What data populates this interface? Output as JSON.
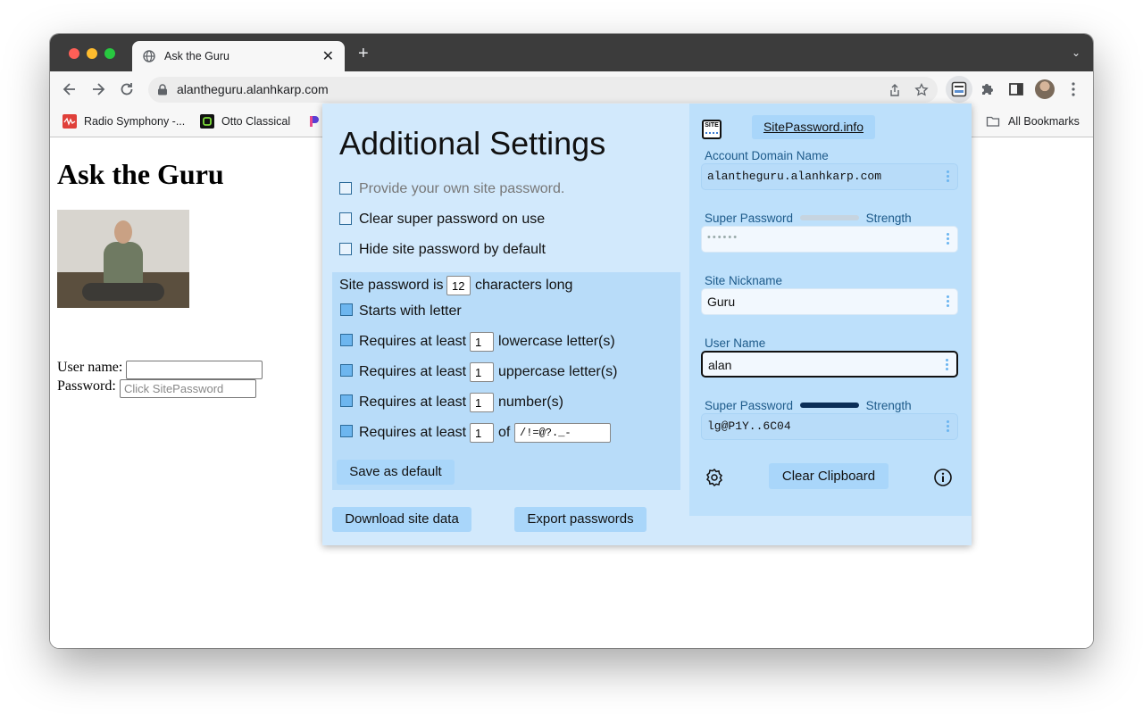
{
  "browser": {
    "tab_title": "Ask the Guru",
    "url": "alantheguru.alanhkarp.com",
    "bookmarks": [
      "Radio Symphony -...",
      "Otto Classical",
      "All Bookmarks"
    ]
  },
  "page": {
    "heading": "Ask the Guru",
    "username_label": "User name:",
    "password_label": "Password:",
    "password_placeholder": "Click SitePassword"
  },
  "popup": {
    "title": "Additional Settings",
    "options": {
      "provide_own": "Provide your own site password.",
      "clear_super": "Clear super password on use",
      "hide_site": "Hide site password by default"
    },
    "rules": {
      "length_prefix": "Site password is",
      "length_value": "12",
      "length_suffix": "characters long",
      "starts_with_letter": "Starts with letter",
      "requires_prefix": "Requires at least",
      "lower_value": "1",
      "lower_suffix": "lowercase letter(s)",
      "upper_value": "1",
      "upper_suffix": "uppercase letter(s)",
      "number_value": "1",
      "number_suffix": "number(s)",
      "special_value": "1",
      "special_of": "of",
      "special_chars": "/!=@?._-"
    },
    "save_default": "Save as default",
    "download": "Download site data",
    "export": "Export passwords",
    "site_icon_text": "SITE",
    "info_link": "SitePassword.info",
    "account_domain_label": "Account Domain Name",
    "account_domain_value": "alantheguru.alanhkarp.com",
    "super_password_label": "Super Password",
    "strength_label": "Strength",
    "super_password_value": "••••••",
    "nickname_label": "Site Nickname",
    "nickname_value": "Guru",
    "username_label": "User Name",
    "username_value": "alan",
    "site_password_label": "Super Password",
    "site_password_value": "lg@P1Y..6C04",
    "clear_clipboard": "Clear Clipboard",
    "colors": {
      "panel": "#d2e9fc",
      "right_panel": "#bde0fb",
      "button": "#a9d6fa",
      "label": "#1d5a8a"
    }
  }
}
